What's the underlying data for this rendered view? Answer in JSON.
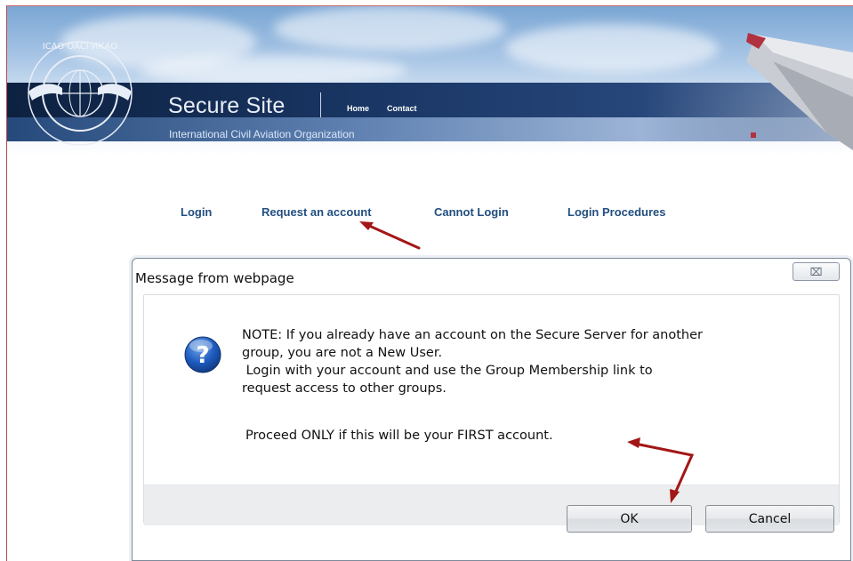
{
  "header": {
    "site_title": "Secure Site",
    "nav": {
      "home": "Home",
      "contact": "Contact"
    },
    "org_name": "International Civil Aviation Organization",
    "logo_text": "ICAO · OACI · ИКАО"
  },
  "links": {
    "login": "Login",
    "request_account": "Request an account",
    "cannot_login": "Cannot Login",
    "login_procedures": "Login Procedures"
  },
  "dialog": {
    "title": "Message from webpage",
    "close_glyph": "⌧",
    "message_lines": [
      "NOTE: If you already have an account on the Secure Server for another",
      "group, you are not a New User.",
      " Login with your account and use the Group Membership link to",
      "request access to other groups."
    ],
    "proceed": "Proceed ONLY if this will be your FIRST account.",
    "ok_label": "OK",
    "cancel_label": "Cancel"
  },
  "colors": {
    "link": "#234f80",
    "annotation_arrow": "#a31616",
    "banner_bar": "#1a3766"
  }
}
